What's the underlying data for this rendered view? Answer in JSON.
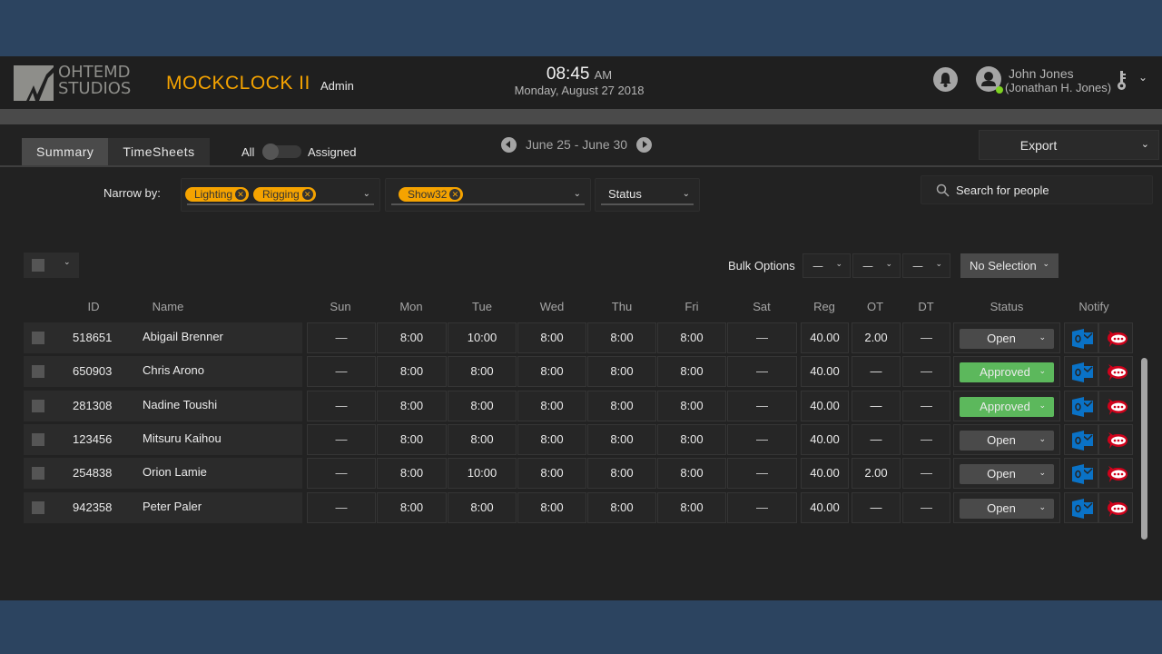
{
  "header": {
    "logo_line1": "OHTEMD",
    "logo_line2": "STUDIOS",
    "app_title": "MOCKCLOCK II",
    "role": "Admin",
    "clock_time": "08:45",
    "clock_ampm": "AM",
    "clock_date": "Monday, August 27 2018",
    "user_name": "John Jones",
    "user_full_name": "(Jonathan H. Jones)",
    "icons": [
      "bell-icon",
      "avatar-icon",
      "key-icon",
      "chevron-down-icon"
    ],
    "status_color": "#7ed321"
  },
  "tabs": [
    {
      "label": "Summary",
      "active": true
    },
    {
      "label": "TimeSheets",
      "active": false
    }
  ],
  "toggle": {
    "left_label": "All",
    "right_label": "Assigned",
    "value": "All"
  },
  "date_nav": {
    "range": "June 25 - June 30"
  },
  "export": {
    "label": "Export"
  },
  "filters": {
    "narrow_label": "Narrow by:",
    "department_chips": [
      "Lighting",
      "Rigging"
    ],
    "show_chips": [
      "Show32"
    ],
    "status_label": "Status",
    "chip_color": "#f5a300"
  },
  "search": {
    "placeholder": "Search for people",
    "value": ""
  },
  "bulk": {
    "label": "Bulk Options",
    "dropdowns": [
      "—",
      "—",
      "—"
    ],
    "selection_label": "No Selection"
  },
  "table": {
    "columns": [
      "ID",
      "Name",
      "Sun",
      "Mon",
      "Tue",
      "Wed",
      "Thu",
      "Fri",
      "Sat",
      "Reg",
      "OT",
      "DT",
      "Status",
      "Notify"
    ],
    "rows": [
      {
        "id": "518651",
        "name": "Abigail Brenner",
        "days": [
          "—",
          "8:00",
          "10:00",
          "8:00",
          "8:00",
          "8:00",
          "—"
        ],
        "reg": "40.00",
        "ot": "2.00",
        "dt": "—",
        "status": "Open"
      },
      {
        "id": "650903",
        "name": "Chris Arono",
        "days": [
          "—",
          "8:00",
          "8:00",
          "8:00",
          "8:00",
          "8:00",
          "—"
        ],
        "reg": "40.00",
        "ot": "—",
        "dt": "—",
        "status": "Approved"
      },
      {
        "id": "281308",
        "name": "Nadine Toushi",
        "days": [
          "—",
          "8:00",
          "8:00",
          "8:00",
          "8:00",
          "8:00",
          "—"
        ],
        "reg": "40.00",
        "ot": "—",
        "dt": "—",
        "status": "Approved"
      },
      {
        "id": "123456",
        "name": "Mitsuru Kaihou",
        "days": [
          "—",
          "8:00",
          "8:00",
          "8:00",
          "8:00",
          "8:00",
          "—"
        ],
        "reg": "40.00",
        "ot": "—",
        "dt": "—",
        "status": "Open"
      },
      {
        "id": "254838",
        "name": "Orion Lamie",
        "days": [
          "—",
          "8:00",
          "10:00",
          "8:00",
          "8:00",
          "8:00",
          "—"
        ],
        "reg": "40.00",
        "ot": "2.00",
        "dt": "—",
        "status": "Open"
      },
      {
        "id": "942358",
        "name": "Peter Paler",
        "days": [
          "—",
          "8:00",
          "8:00",
          "8:00",
          "8:00",
          "8:00",
          "—"
        ],
        "reg": "40.00",
        "ot": "—",
        "dt": "—",
        "status": "Open"
      }
    ],
    "status_colors": {
      "Open": "#4a4a4a",
      "Approved": "#5cb85c"
    },
    "notify_icons": [
      "outlook-icon",
      "chat-icon"
    ]
  }
}
